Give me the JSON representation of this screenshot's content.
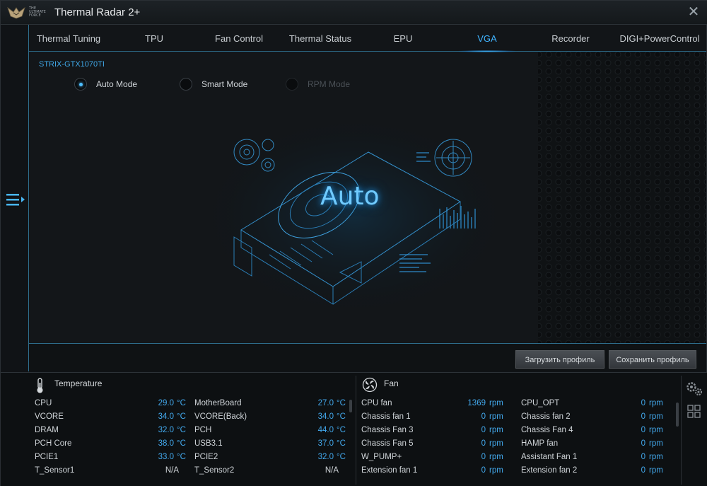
{
  "window": {
    "title": "Thermal Radar 2+",
    "logo_text": "THE ULTIMATE FORCE"
  },
  "tabs": [
    {
      "label": "Thermal Tuning",
      "active": false
    },
    {
      "label": "TPU",
      "active": false
    },
    {
      "label": "Fan Control",
      "active": false
    },
    {
      "label": "Thermal Status",
      "active": false
    },
    {
      "label": "EPU",
      "active": false
    },
    {
      "label": "VGA",
      "active": true
    },
    {
      "label": "Recorder",
      "active": false
    },
    {
      "label": "DIGI+PowerControl",
      "active": false
    }
  ],
  "vga": {
    "device_name": "STRIX-GTX1070TI",
    "modes": [
      {
        "label": "Auto Mode",
        "selected": true,
        "enabled": true
      },
      {
        "label": "Smart Mode",
        "selected": false,
        "enabled": true
      },
      {
        "label": "RPM Mode",
        "selected": false,
        "enabled": false
      }
    ],
    "mode_display": "Auto",
    "load_profile_label": "Загрузить профиль",
    "save_profile_label": "Сохранить профиль"
  },
  "temperature": {
    "title": "Temperature",
    "left": [
      {
        "name": "CPU",
        "value": "29.0",
        "unit": "°C"
      },
      {
        "name": "VCORE",
        "value": "34.0",
        "unit": "°C"
      },
      {
        "name": "DRAM",
        "value": "32.0",
        "unit": "°C"
      },
      {
        "name": "PCH Core",
        "value": "38.0",
        "unit": "°C"
      },
      {
        "name": "PCIE1",
        "value": "33.0",
        "unit": "°C"
      },
      {
        "name": "T_Sensor1",
        "value": "N/A",
        "unit": ""
      }
    ],
    "right": [
      {
        "name": "MotherBoard",
        "value": "27.0",
        "unit": "°C"
      },
      {
        "name": "VCORE(Back)",
        "value": "34.0",
        "unit": "°C"
      },
      {
        "name": "PCH",
        "value": "44.0",
        "unit": "°C"
      },
      {
        "name": "USB3.1",
        "value": "37.0",
        "unit": "°C"
      },
      {
        "name": "PCIE2",
        "value": "32.0",
        "unit": "°C"
      },
      {
        "name": "T_Sensor2",
        "value": "N/A",
        "unit": ""
      }
    ]
  },
  "fan": {
    "title": "Fan",
    "left": [
      {
        "name": "CPU fan",
        "value": "1369",
        "unit": "rpm"
      },
      {
        "name": "Chassis fan 1",
        "value": "0",
        "unit": "rpm"
      },
      {
        "name": "Chassis Fan 3",
        "value": "0",
        "unit": "rpm"
      },
      {
        "name": "Chassis Fan 5",
        "value": "0",
        "unit": "rpm"
      },
      {
        "name": "W_PUMP+",
        "value": "0",
        "unit": "rpm"
      },
      {
        "name": "Extension fan 1",
        "value": "0",
        "unit": "rpm"
      }
    ],
    "right": [
      {
        "name": "CPU_OPT",
        "value": "0",
        "unit": "rpm"
      },
      {
        "name": "Chassis fan 2",
        "value": "0",
        "unit": "rpm"
      },
      {
        "name": "Chassis Fan 4",
        "value": "0",
        "unit": "rpm"
      },
      {
        "name": "HAMP fan",
        "value": "0",
        "unit": "rpm"
      },
      {
        "name": "Assistant Fan 1",
        "value": "0",
        "unit": "rpm"
      },
      {
        "name": "Extension fan 2",
        "value": "0",
        "unit": "rpm"
      }
    ]
  },
  "icons": {
    "menu": "menu-expand-icon",
    "close": "close-icon",
    "thermometer": "thermometer-icon",
    "fan": "fan-icon",
    "settings": "gears-icon",
    "grid": "grid-view-icon"
  },
  "colors": {
    "accent": "#40b4ff",
    "value": "#42a8ec",
    "background": "#0f1214"
  }
}
